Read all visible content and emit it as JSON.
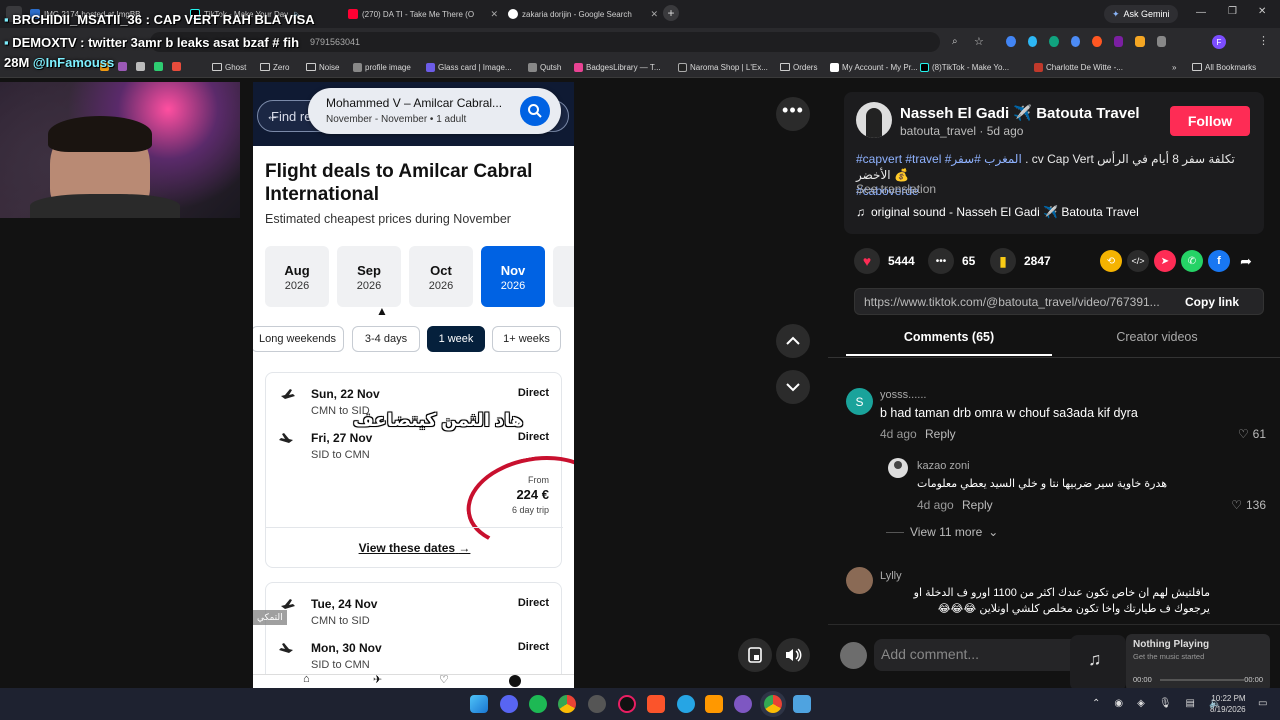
{
  "browser": {
    "tabs": [
      {
        "title": "IMG 2174 hosted at ImgBB"
      },
      {
        "title": "TikTok - Make Your Day"
      },
      {
        "title": "(270) DA TI - Take Me There (O"
      },
      {
        "title": "zakaria dorijin - Google Search"
      }
    ],
    "ask_gemini": "Ask Gemini",
    "url_fragment": "9791563041",
    "bookmarks": [
      "Ghost",
      "Zero",
      "Noise",
      "profile image",
      "Glass card | Image...",
      "Qutsh",
      "BadgesLibrary — T...",
      "Naroma Shop | L'Ex...",
      "Orders",
      "My Account - My Pr...",
      "(8)TikTok - Make Yo...",
      "Charlotte De Witte -..."
    ],
    "all_bookmarks": "All Bookmarks"
  },
  "stream_overlay": {
    "line1": "BRCHIDII_MSATII_36 : CAP VERT RAH BLA VISA",
    "line2": "DEMOXTV : twitter 3amr b leaks asat bzaf # fih",
    "line3": "28M",
    "line3_handle": "@InFamouss"
  },
  "video": {
    "search_placeholder": "Find related content",
    "route": "Mohammed V – Amilcar Cabral...",
    "route_sub": "November - November • 1 adult",
    "heading": "Flight deals to Amilcar Cabral International",
    "subheading": "Estimated cheapest prices during November",
    "months": [
      {
        "m": "Aug",
        "y": "2026",
        "active": false
      },
      {
        "m": "Sep",
        "y": "2026",
        "active": false
      },
      {
        "m": "Oct",
        "y": "2026",
        "active": false
      },
      {
        "m": "Nov",
        "y": "2026",
        "active": true
      }
    ],
    "chips": [
      {
        "label": "Long weekends",
        "active": false
      },
      {
        "label": "3-4 days",
        "active": false
      },
      {
        "label": "1 week",
        "active": true
      },
      {
        "label": "1+ weeks",
        "active": false
      }
    ],
    "deal1": {
      "out_date": "Sun, 22 Nov",
      "out_route": "CMN to SID",
      "out_type": "Direct",
      "ret_date": "Fri, 27 Nov",
      "ret_route": "SID to CMN",
      "ret_type": "Direct",
      "from_label": "From",
      "price": "224 €",
      "trip": "6 day trip",
      "cta": "View these dates"
    },
    "deal2": {
      "out_date": "Tue, 24 Nov",
      "out_route": "CMN to SID",
      "out_type": "Direct",
      "ret_date": "Mon, 30 Nov",
      "ret_route": "SID to CMN",
      "ret_type": "Direct"
    },
    "arabic_caption": "هاد الثمن كيتضاعف",
    "watermark": "التمكي"
  },
  "post": {
    "author": "Nasseh El Gadi ✈️ Batouta Travel",
    "handle": "batouta_travel",
    "age": "5d ago",
    "follow": "Follow",
    "caption_tags": "#capvert #travel #المغرب #سفر",
    "caption_text": " . cv Cap Vert تكلفة سفر 8 أيام في الرأس الأخضر 💰",
    "caption_tag2": "#caboverde",
    "see_translation": "See translation",
    "sound": "original sound - Nasseh El Gadi ✈️ Batouta Travel",
    "likes": "5444",
    "comments_count": "65",
    "saves": "2847",
    "link": "https://www.tiktok.com/@batouta_travel/video/767391...",
    "copy_link": "Copy link",
    "tab_comments": "Comments (65)",
    "tab_creator": "Creator videos",
    "add_comment": "Add comment..."
  },
  "comments": [
    {
      "user": "yosss......",
      "avatar": "S",
      "text": "b had taman drb omra w chouf sa3ada kif dyra",
      "age": "4d ago",
      "reply": "Reply",
      "likes": "61"
    },
    {
      "user": "kazao zoni",
      "text": "هدرة خاوية سير ضربيها نتا و خلي السيد يعطي معلومات",
      "age": "4d ago",
      "reply": "Reply",
      "likes": "136"
    },
    {
      "user": "Lylly",
      "text": "مافلتيش لهم ان خاص تكون عندك اكثر من 1100 اورو ف الدخلة او يرجعوك ف طيارتك واخا تكون مخلص كلشي اونلاين 😂😂😂"
    }
  ],
  "view_more": "View 11 more",
  "media": {
    "title": "Nothing Playing",
    "subtitle": "Get the music started",
    "time_start": "00:00",
    "time_end": "00:00"
  },
  "clock": {
    "time": "10:22 PM",
    "date": "8/19/2026"
  },
  "colors": {
    "follow": "#fe2c55",
    "active_month": "#0062e3",
    "chip_active": "#05203c",
    "like": "#fe2c55",
    "save": "#facc15"
  }
}
